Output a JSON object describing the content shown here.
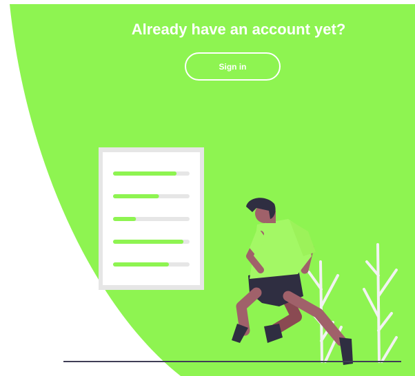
{
  "panel": {
    "heading": "Already have an account yet?",
    "button_label": "Sign in"
  },
  "illustration": {
    "subject": "person-running-past-checklist",
    "progress_levels": [
      0.83,
      0.6,
      0.3,
      0.92,
      0.73
    ]
  },
  "colors": {
    "panel_bg": "#8ef451",
    "accent": "#8ef451",
    "shirt": "#a3f865",
    "skin": "#a0616a",
    "hair": "#2f2e41",
    "shorts": "#2f2e41",
    "track": "#e6e6e6",
    "card_border": "#e6e6e6",
    "plant": "#f2f2f2",
    "ground": "#3f3d56"
  }
}
